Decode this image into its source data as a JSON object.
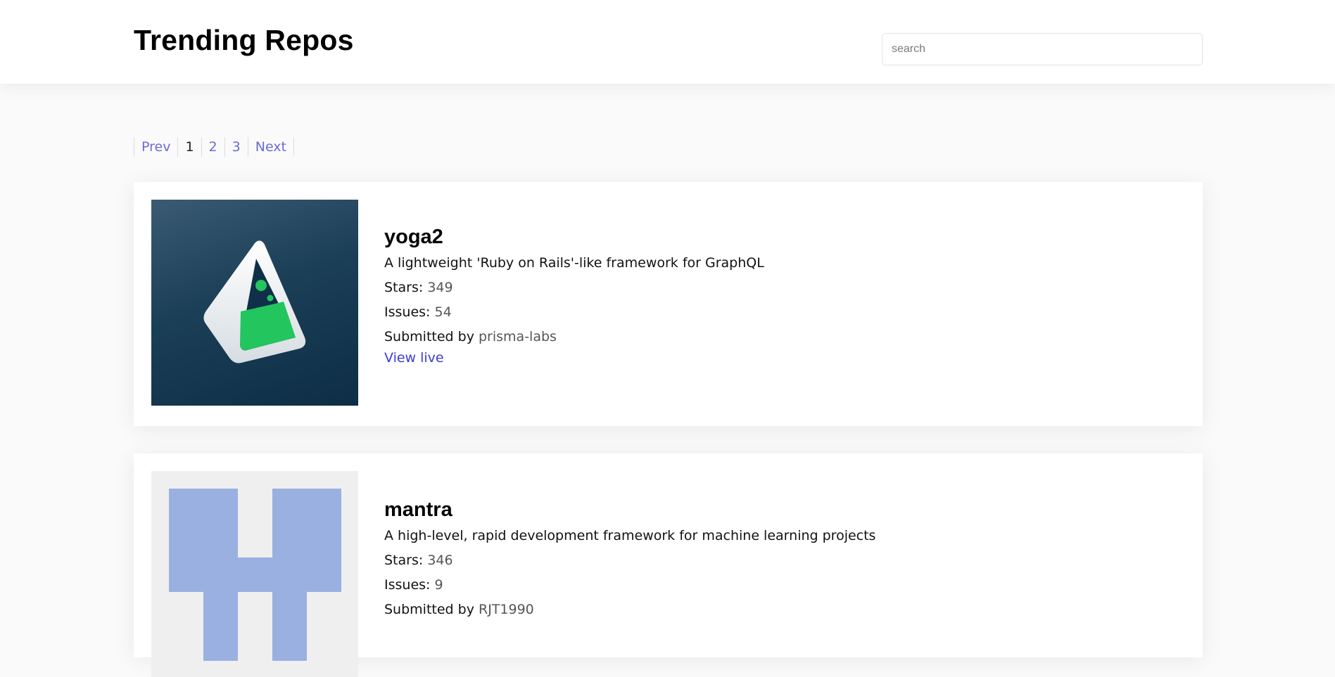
{
  "header": {
    "title": "Trending Repos",
    "search_placeholder": "search"
  },
  "pagination": {
    "prev": "Prev",
    "pages": [
      "1",
      "2",
      "3"
    ],
    "current": "1",
    "next": "Next"
  },
  "repos": [
    {
      "name": "yoga2",
      "description": "A lightweight 'Ruby on Rails'-like framework for GraphQL",
      "stars_label": "Stars:",
      "stars": "349",
      "issues_label": "Issues:",
      "issues": "54",
      "submitted_label": "Submitted by",
      "submitted_by": "prisma-labs",
      "view_live": "View live",
      "logo_icon": "prisma-flask-icon",
      "logo_colors": {
        "bg": "#1b3f57",
        "flask": "#22c55e",
        "outline": "#ffffff"
      }
    },
    {
      "name": "mantra",
      "description": "A high-level, rapid development framework for machine learning projects",
      "stars_label": "Stars:",
      "stars": "346",
      "issues_label": "Issues:",
      "issues": "9",
      "submitted_label": "Submitted by",
      "submitted_by": "RJT1990",
      "logo_icon": "identicon-icon",
      "logo_colors": {
        "bg": "#efefef",
        "fill": "#9ab0e0"
      }
    }
  ],
  "colors": {
    "link": "#3b3bd6",
    "pagination_link": "#6b6bd6",
    "muted_value": "#555555"
  }
}
